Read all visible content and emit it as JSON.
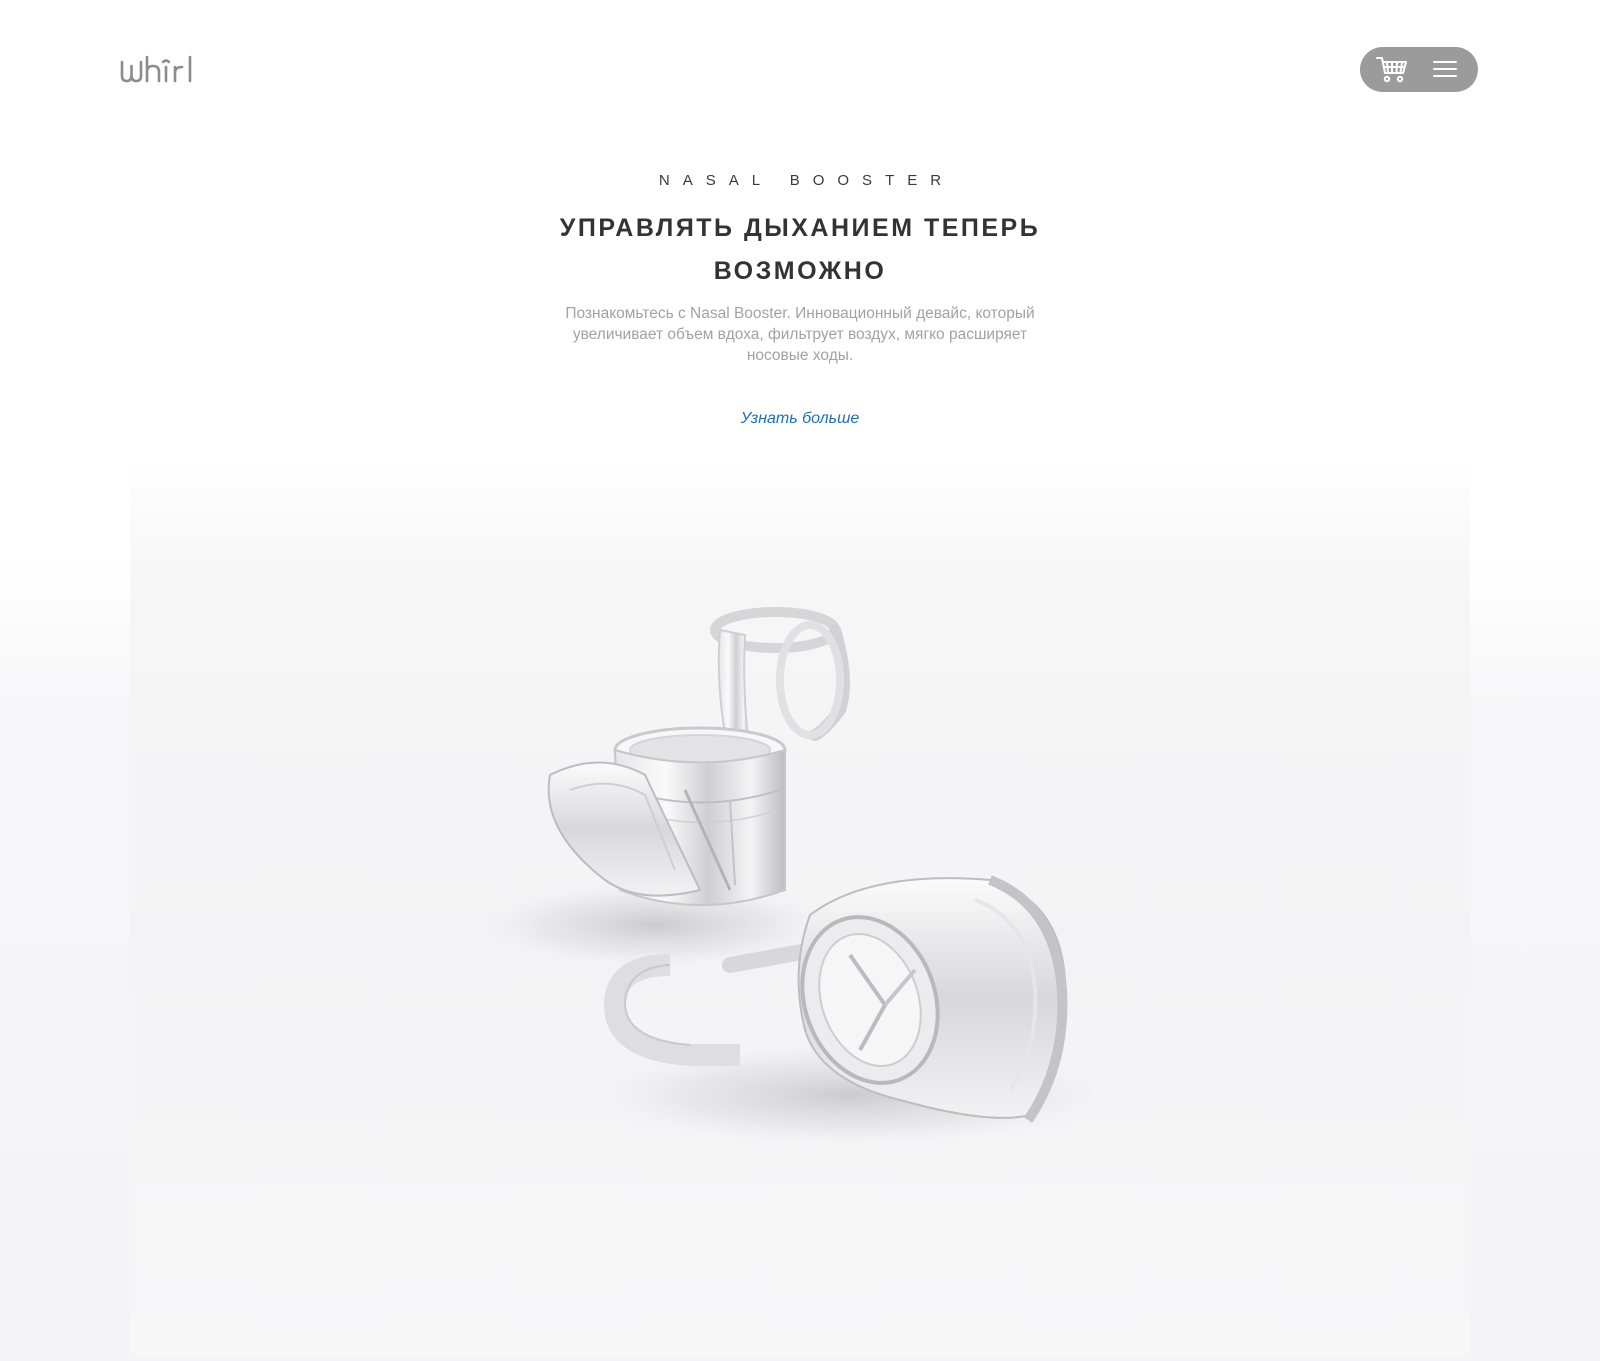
{
  "header": {
    "logo_text": "whirl",
    "logo_icon": "whirl-logo",
    "cart_icon": "cart-icon",
    "menu_icon": "hamburger-menu-icon",
    "pill_color": "#9b9b9b"
  },
  "hero": {
    "eyebrow": "NASAL BOOSTER",
    "headline": "УПРАВЛЯТЬ ДЫХАНИЕМ ТЕПЕРЬ ВОЗМОЖНО",
    "lead": "Познакомьтесь с Nasal Booster. Инновационный девайс, который увеличивает объем вдоха, фильтрует воздух, мягко расширяет носовые ходы.",
    "cta_label": "Узнать больше",
    "cta_color": "#1a6fc4"
  },
  "product": {
    "image_subject": "two transparent nasal booster devices"
  }
}
